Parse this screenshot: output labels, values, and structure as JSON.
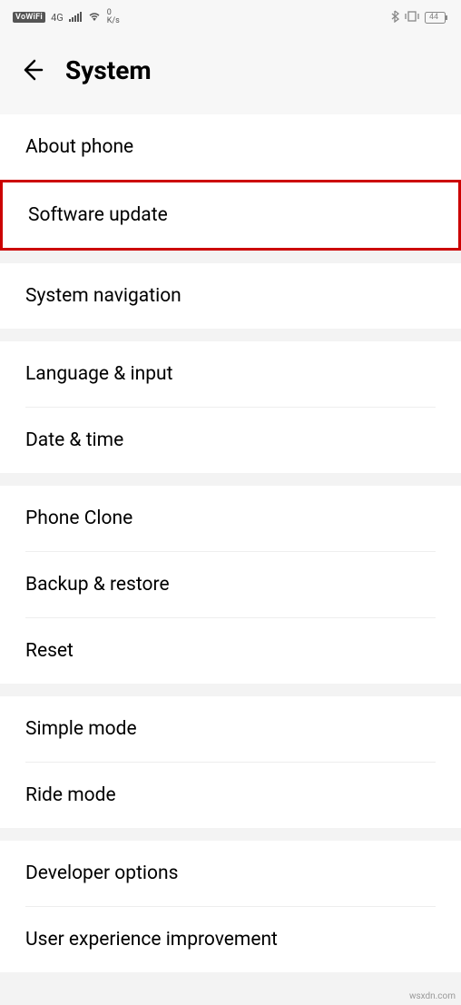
{
  "status": {
    "vowifi": "VoWiFi",
    "net_label": "4G",
    "speed_value": "0",
    "speed_unit": "K/s",
    "battery": "44"
  },
  "header": {
    "title": "System"
  },
  "sections": {
    "s0_item0": "About phone",
    "s0_item1": "Software update",
    "s1_item0": "System navigation",
    "s2_item0": "Language & input",
    "s2_item1": "Date & time",
    "s3_item0": "Phone Clone",
    "s3_item1": "Backup & restore",
    "s3_item2": "Reset",
    "s4_item0": "Simple mode",
    "s4_item1": "Ride mode",
    "s5_item0": "Developer options",
    "s5_item1": "User experience improvement"
  },
  "watermark": "wsxdn.com"
}
